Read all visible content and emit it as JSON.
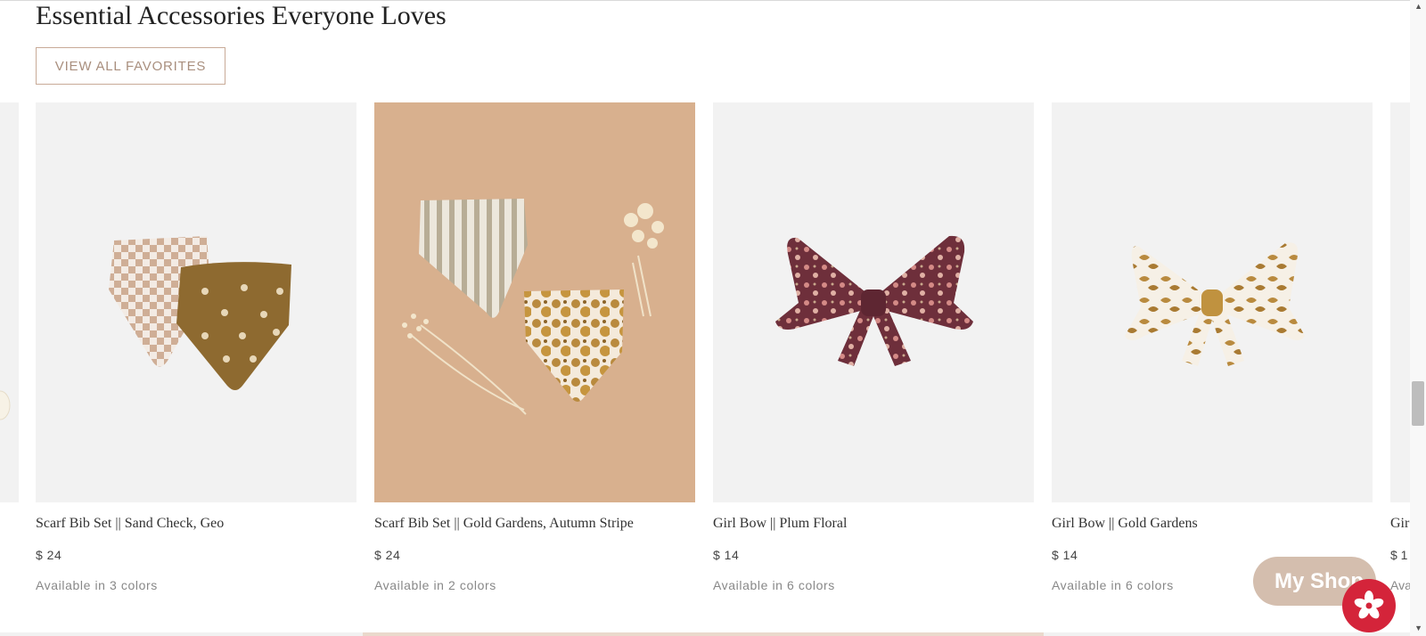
{
  "section": {
    "title": "Essential Accessories Everyone Loves",
    "view_all_label": "VIEW ALL FAVORITES"
  },
  "products": [
    {
      "name": "Scarf Bib Set || Sand Check, Geo",
      "price": "$ 24",
      "colors": "Available in 3 colors"
    },
    {
      "name": "Scarf Bib Set || Gold Gardens, Autumn Stripe",
      "price": "$ 24",
      "colors": "Available in 2 colors"
    },
    {
      "name": "Girl Bow || Plum Floral",
      "price": "$ 14",
      "colors": "Available in 6 colors"
    },
    {
      "name": "Girl Bow || Gold Gardens",
      "price": "$ 14",
      "colors": "Available in 6 colors"
    }
  ],
  "partial_product": {
    "name": "Gir",
    "price": "$ 1",
    "colors": "Ava"
  },
  "widget": {
    "my_shop_label": "My Shop"
  },
  "colors": {
    "accent_tan": "#c8aa97",
    "image_bg": "#f2f2f2",
    "tan_photo_bg": "#d8b08e",
    "brand_red": "#d4243a"
  }
}
